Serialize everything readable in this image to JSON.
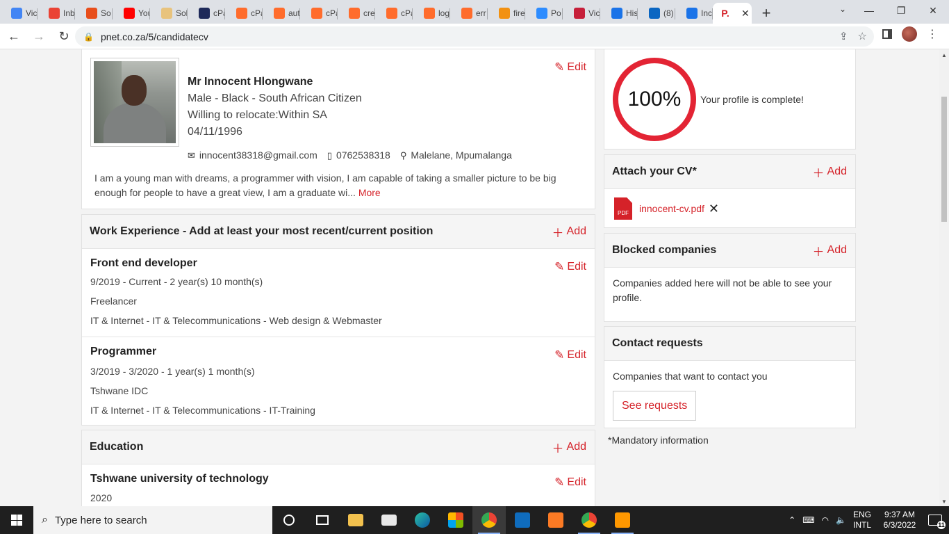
{
  "browser": {
    "tabs": [
      {
        "label": "Vic",
        "icon": "chrome-icon",
        "color": "#4285f4"
      },
      {
        "label": "Inb",
        "icon": "gmail-icon",
        "color": "#ea4335"
      },
      {
        "label": "So",
        "icon": "upwork-icon",
        "color": "#e84e1b"
      },
      {
        "label": "You",
        "icon": "youtube-icon",
        "color": "#ff0000"
      },
      {
        "label": "Sol",
        "icon": "solution-icon",
        "color": "#e8c37d"
      },
      {
        "label": "cPa",
        "icon": "shield-icon",
        "color": "#1e2a5a"
      },
      {
        "label": "cPa",
        "icon": "cpanel-icon",
        "color": "#ff6c2c"
      },
      {
        "label": "aut",
        "icon": "cpanel-icon",
        "color": "#ff6c2c"
      },
      {
        "label": "cPa",
        "icon": "cpanel-icon",
        "color": "#ff6c2c"
      },
      {
        "label": "cre",
        "icon": "cpanel-icon",
        "color": "#ff6c2c"
      },
      {
        "label": "cPa",
        "icon": "cpanel-icon",
        "color": "#ff6c2c"
      },
      {
        "label": "log",
        "icon": "cpanel-icon",
        "color": "#ff6c2c"
      },
      {
        "label": "err",
        "icon": "cpanel-icon",
        "color": "#ff6c2c"
      },
      {
        "label": "fire",
        "icon": "pma-icon",
        "color": "#f29111"
      },
      {
        "label": "Po",
        "icon": "zoom-icon",
        "color": "#2d8cff"
      },
      {
        "label": "Vic",
        "icon": "check-icon",
        "color": "#c61f3a"
      },
      {
        "label": "His",
        "icon": "history-icon",
        "color": "#1a73e8"
      },
      {
        "label": "(8)",
        "icon": "linkedin-icon",
        "color": "#0a66c2"
      },
      {
        "label": "Inc",
        "icon": "info-icon",
        "color": "#1a73e8"
      }
    ],
    "active_tab_icon": "pnet-icon",
    "active_tab_close": "✕",
    "new_tab": "+",
    "url": "pnet.co.za/5/candidatecv"
  },
  "profile": {
    "name": "Mr Innocent Hlongwane",
    "demographics": "Male - Black - South African Citizen",
    "relocate": "Willing to relocate:Within SA",
    "dob": "04/11/1996",
    "email": "innocent38318@gmail.com",
    "phone": "0762538318",
    "location": "Malelane, Mpumalanga",
    "bio": "I am a young man with dreams, a programmer with vision, I am capable of taking a smaller picture to be big enough for people to have a great view, I am a graduate wi...",
    "more": "More",
    "edit": "Edit"
  },
  "work": {
    "heading": "Work Experience - Add at least your most recent/current position",
    "add": "Add",
    "entries": [
      {
        "title": "Front end developer",
        "period": "9/2019 - Current - 2 year(s) 10 month(s)",
        "company": "Freelancer",
        "category": "IT & Internet - IT & Telecommunications - Web design & Webmaster",
        "edit": "Edit"
      },
      {
        "title": "Programmer",
        "period": "3/2019 - 3/2020 - 1 year(s) 1 month(s)",
        "company": "Tshwane IDC",
        "category": "IT & Internet - IT & Telecommunications - IT-Training",
        "edit": "Edit"
      }
    ]
  },
  "education": {
    "heading": "Education",
    "add": "Add",
    "entries": [
      {
        "title": "Tshwane university of technology",
        "year": "2020",
        "edit": "Edit"
      }
    ]
  },
  "completion": {
    "percent": "100%",
    "fraction": 1.0,
    "text": "Your profile is complete!",
    "ring_color": "#e32434"
  },
  "attach_cv": {
    "heading": "Attach your CV*",
    "add": "Add",
    "file": "innocent-cv.pdf",
    "pdf_label": "PDF"
  },
  "blocked": {
    "heading": "Blocked companies",
    "add": "Add",
    "text": "Companies added here will not be able to see your profile."
  },
  "contact_requests": {
    "heading": "Contact requests",
    "text": "Companies that want to contact you",
    "button": "See requests"
  },
  "mandatory": "*Mandatory information",
  "taskbar": {
    "search_placeholder": "Type here to search",
    "lang_top": "ENG",
    "lang_bottom": "INTL",
    "time": "9:37 AM",
    "date": "6/3/2022",
    "notifications": "11"
  },
  "colors": {
    "accent": "#d52229",
    "taskbar": "#1f1f1f"
  }
}
